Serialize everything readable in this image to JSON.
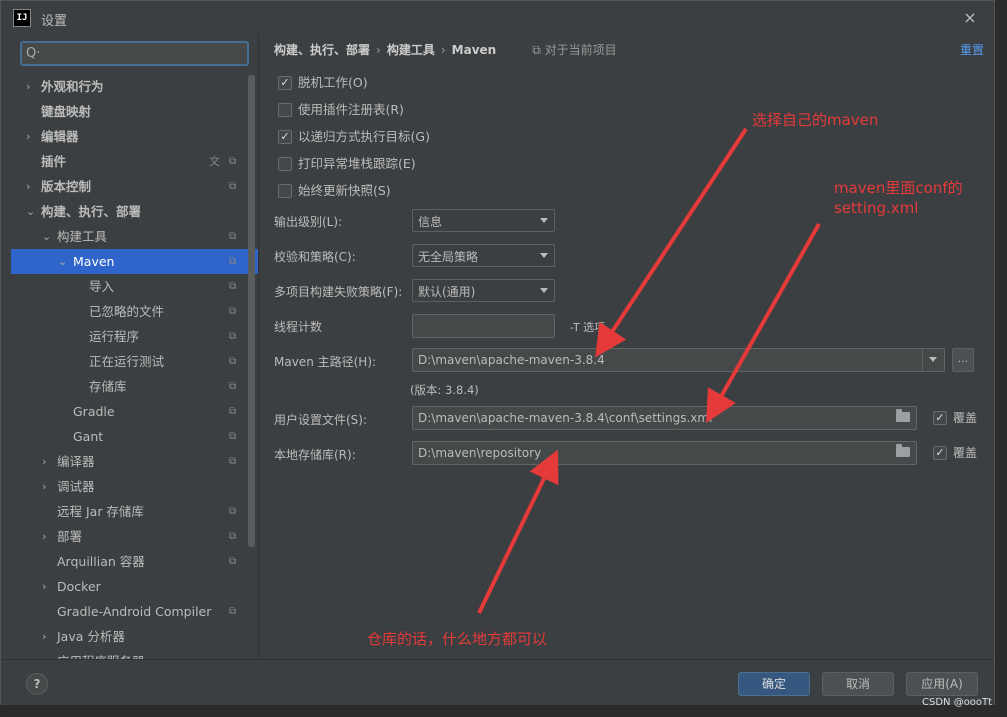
{
  "window": {
    "title": "设置",
    "close_icon": "×"
  },
  "sidebar": {
    "search_icon": "Q·",
    "search_placeholder": "",
    "items": [
      {
        "label": "外观和行为",
        "chev": "›",
        "bold": true
      },
      {
        "label": "键盘映射",
        "chev": "",
        "bold": true
      },
      {
        "label": "编辑器",
        "chev": "›",
        "bold": true
      },
      {
        "label": "插件",
        "chev": "",
        "bold": true,
        "has_translate": true
      },
      {
        "label": "版本控制",
        "chev": "›",
        "bold": true
      },
      {
        "label": "构建、执行、部署",
        "chev": "⌄",
        "bold": true
      },
      {
        "label": "构建工具",
        "chev": "⌄"
      },
      {
        "label": "Maven",
        "chev": "⌄",
        "selected": true
      },
      {
        "label": "导入"
      },
      {
        "label": "已忽略的文件"
      },
      {
        "label": "运行程序"
      },
      {
        "label": "正在运行测试"
      },
      {
        "label": "存储库"
      },
      {
        "label": "Gradle"
      },
      {
        "label": "Gant"
      },
      {
        "label": "编译器",
        "chev": "›"
      },
      {
        "label": "调试器",
        "chev": "›"
      },
      {
        "label": "远程 Jar 存储库"
      },
      {
        "label": "部署",
        "chev": "›"
      },
      {
        "label": "Arquillian 容器"
      },
      {
        "label": "Docker",
        "chev": "›"
      },
      {
        "label": "Gradle-Android Compiler"
      },
      {
        "label": "Java 分析器",
        "chev": "›"
      },
      {
        "label": "应用程序服务器"
      }
    ]
  },
  "breadcrumb": {
    "part1": "构建、执行、部署",
    "part2": "构建工具",
    "part3": "Maven",
    "separator": "›",
    "scope": "⧉ 对于当前项目"
  },
  "reset_label": "重置",
  "checkboxes": [
    {
      "label": "脱机工作(O)",
      "checked": true
    },
    {
      "label": "使用插件注册表(R)",
      "checked": false
    },
    {
      "label": "以递归方式执行目标(G)",
      "checked": true
    },
    {
      "label": "打印异常堆栈跟踪(E)",
      "checked": false
    },
    {
      "label": "始终更新快照(S)",
      "checked": false
    }
  ],
  "fields": {
    "output_level": {
      "label": "输出级别(L):",
      "value": "信息"
    },
    "checksum_policy": {
      "label": "校验和策略(C):",
      "value": "无全局策略"
    },
    "fail_policy": {
      "label": "多项目构建失败策略(F):",
      "value": "默认(通用)"
    },
    "thread_count": {
      "label": "线程计数",
      "value": "",
      "suffix": "-T 选项"
    },
    "maven_home": {
      "label": "Maven 主路径(H):",
      "value": "D:\\maven\\apache-maven-3.8.4",
      "browse": "...",
      "version": "(版本: 3.8.4)"
    },
    "user_settings": {
      "label": "用户设置文件(S):",
      "value": "D:\\maven\\apache-maven-3.8.4\\conf\\settings.xml",
      "override_label": "覆盖",
      "override_checked": true
    },
    "local_repo": {
      "label": "本地存储库(R):",
      "value": "D:\\maven\\repository",
      "override_label": "覆盖",
      "override_checked": true
    }
  },
  "annotations": {
    "a1": "选择自己的maven",
    "a2_line1": "maven里面conf的",
    "a2_line2": "setting.xml",
    "a3": "仓库的话，什么地方都可以",
    "color": "#e53a3a"
  },
  "footer": {
    "help": "?",
    "ok": "确定",
    "cancel": "取消",
    "apply": "应用(A)"
  },
  "watermark": "CSDN @oooTt"
}
